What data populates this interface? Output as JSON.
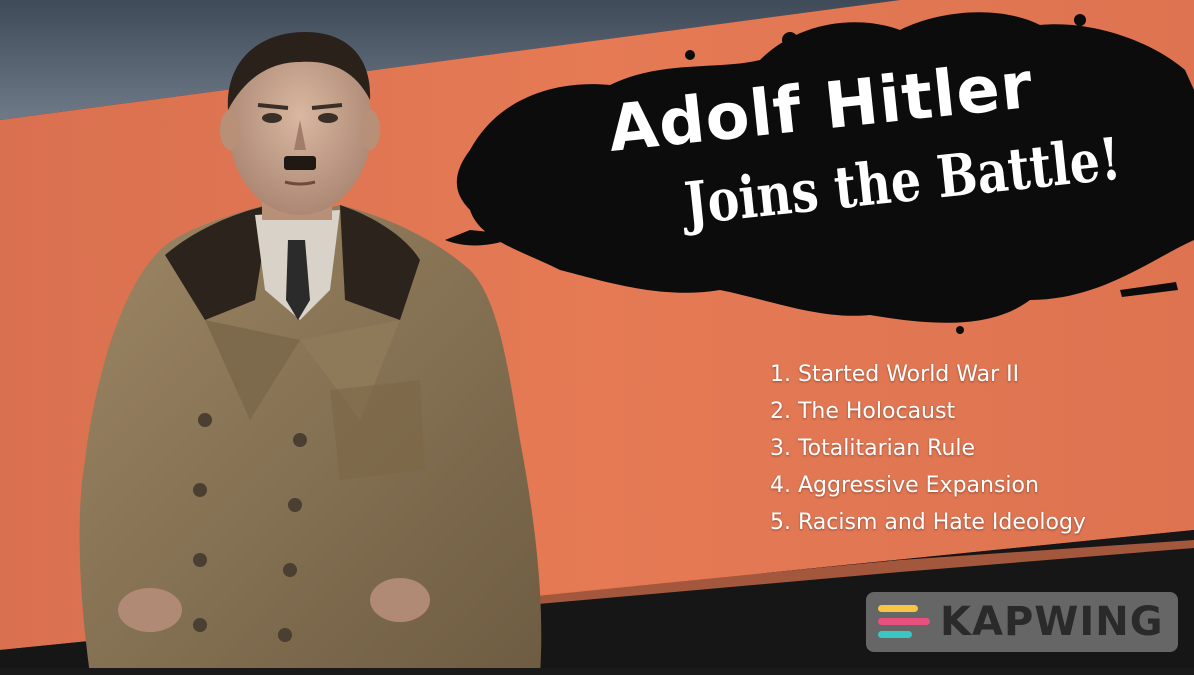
{
  "title": {
    "line1": "Adolf Hitler",
    "line2": "Joins the Battle!"
  },
  "achievements": [
    "1. Started World War II",
    "2. The Holocaust",
    "3. Totalitarian Rule",
    "4. Aggressive Expansion",
    "5. Racism and Hate Ideology"
  ],
  "watermark": {
    "text": "KAPWING",
    "icon": "kapwing-logo-icon"
  },
  "colors": {
    "orange_band": "#e0734f",
    "dark_background": "#161616",
    "sky_top": "#4a5666",
    "ink_splash": "#0c0c0c",
    "title_text": "#ffffff",
    "coat": "#8a7555"
  },
  "figure": {
    "icon": "portrait-figure-in-trench-coat"
  }
}
